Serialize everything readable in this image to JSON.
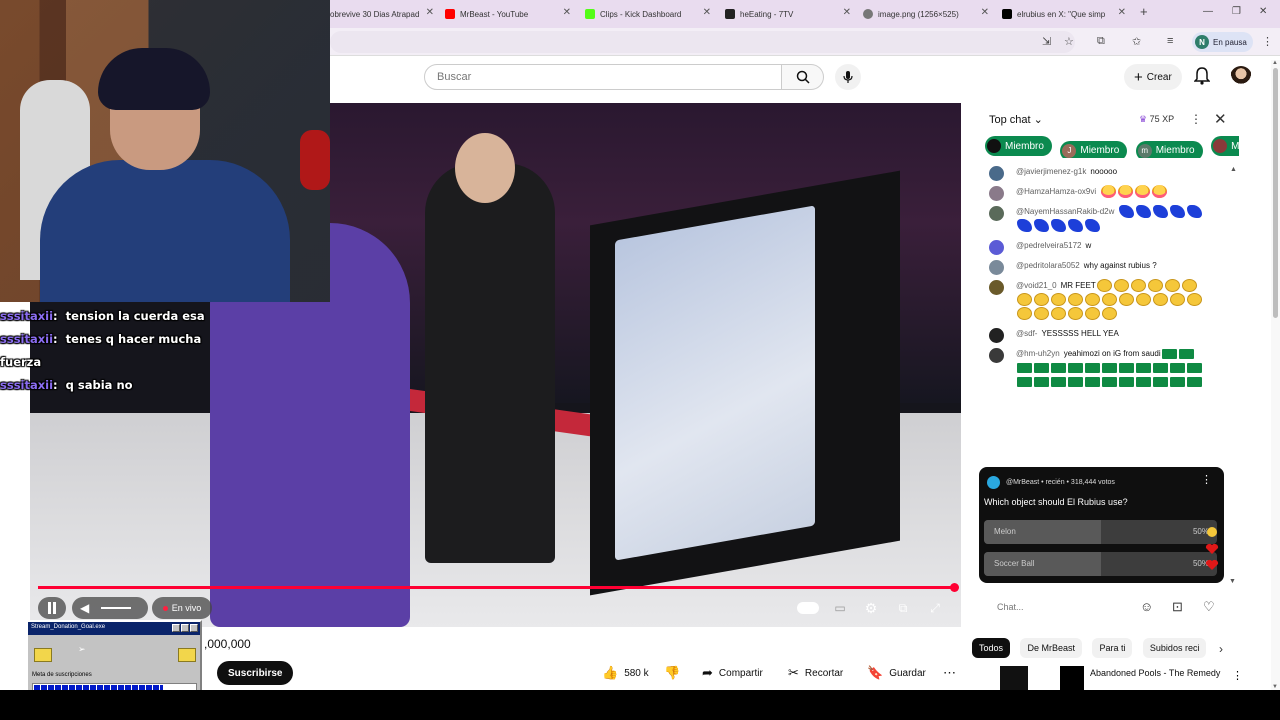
{
  "browser": {
    "tabs": [
      {
        "label": "obrevive 30 Dias Atrapad",
        "color": "#4a4a4a"
      },
      {
        "label": "MrBeast - YouTube",
        "color": "#ff0000"
      },
      {
        "label": "Clips - Kick Dashboard",
        "color": "#53fc18"
      },
      {
        "label": "heEating - 7TV",
        "color": "#222222"
      },
      {
        "label": "image.png (1256×525)",
        "color": "#777777"
      },
      {
        "label": "elrubius en X: \"Que simp",
        "color": "#000000"
      }
    ],
    "new_tab": "+",
    "profile_initial": "N",
    "profile_status": "En pausa"
  },
  "youtube": {
    "search_placeholder": "Buscar",
    "create_label": "Crear",
    "views": ",000,000",
    "subscribe_label": "Suscribirse",
    "likes": "580 k",
    "share_label": "Compartir",
    "clip_label": "Recortar",
    "save_label": "Guardar"
  },
  "player": {
    "live_label": "En vivo",
    "progress": 1.0
  },
  "stream_chat": [
    {
      "user": "sssitaxii",
      "sep": ":",
      "text": "tension la cuerda esa"
    },
    {
      "user": "sssitaxii",
      "sep": ":",
      "text": "tenes q hacer mucha"
    },
    {
      "user": "",
      "sep": "",
      "text": "fuerza"
    },
    {
      "user": "sssitaxii",
      "sep": ":",
      "text": "q sabia no"
    }
  ],
  "donation": {
    "title": "Stream_Donation_Goal.exe",
    "label": "Meta de suscripciones",
    "progress": 0.8
  },
  "live_chat": {
    "title": "Top chat",
    "xp": "75 XP",
    "chips": [
      {
        "initial": "",
        "label": "Miembro",
        "avatar_color": "#111111"
      },
      {
        "initial": "J",
        "label": "Miembro",
        "avatar_color": "#9a6b5a"
      },
      {
        "initial": "m",
        "label": "Miembro",
        "avatar_color": "#5a7a6a"
      },
      {
        "initial": "",
        "label": "Mi",
        "avatar_color": "#8a3a3a"
      }
    ],
    "messages": [
      {
        "author": "@javierjimenez-g1k",
        "text": "nooooo",
        "avatar_color": "#4a6a8a",
        "emoji": "",
        "count": 0
      },
      {
        "author": "@HamzaHamza-ox9vi",
        "text": "",
        "avatar_color": "#8a7a8a",
        "emoji": "star",
        "count": 4
      },
      {
        "author": "@NayemHassanRakib-d2w",
        "text": "",
        "avatar_color": "#5a6a5a",
        "emoji": "blue",
        "count": 10
      },
      {
        "author": "@pedrelveira5172",
        "text": "w",
        "avatar_color": "#5b5bd6",
        "emoji": "",
        "count": 0
      },
      {
        "author": "@pedritolara5052",
        "text": "why against rubius ?",
        "avatar_color": "#7a8a9a",
        "emoji": "",
        "count": 0
      },
      {
        "author": "@void21_0",
        "text": "MR FEET",
        "avatar_color": "#6a5a2a",
        "emoji": "sad",
        "count": 23
      },
      {
        "author": "@sdf-",
        "text": "YESSSSS HELL YEA",
        "avatar_color": "#222222",
        "emoji": "",
        "count": 0
      },
      {
        "author": "@hm-uh2yn",
        "text": "yeahimozi on iG from saudi",
        "avatar_color": "#3a3a3a",
        "emoji": "flag",
        "count": 24
      }
    ],
    "input_placeholder": "Chat..."
  },
  "poll": {
    "author": "@MrBeast",
    "meta": "• recién • 318,444 votos",
    "question": "Which object should El Rubius use?",
    "options": [
      {
        "label": "Melon",
        "pct": "50%",
        "fraction": 0.5
      },
      {
        "label": "Soccer Ball",
        "pct": "50%",
        "fraction": 0.5
      }
    ]
  },
  "filters": [
    "Todos",
    "De MrBeast",
    "Para ti",
    "Subidos reci"
  ],
  "recommended": {
    "title": "Abandoned Pools - The Remedy"
  }
}
